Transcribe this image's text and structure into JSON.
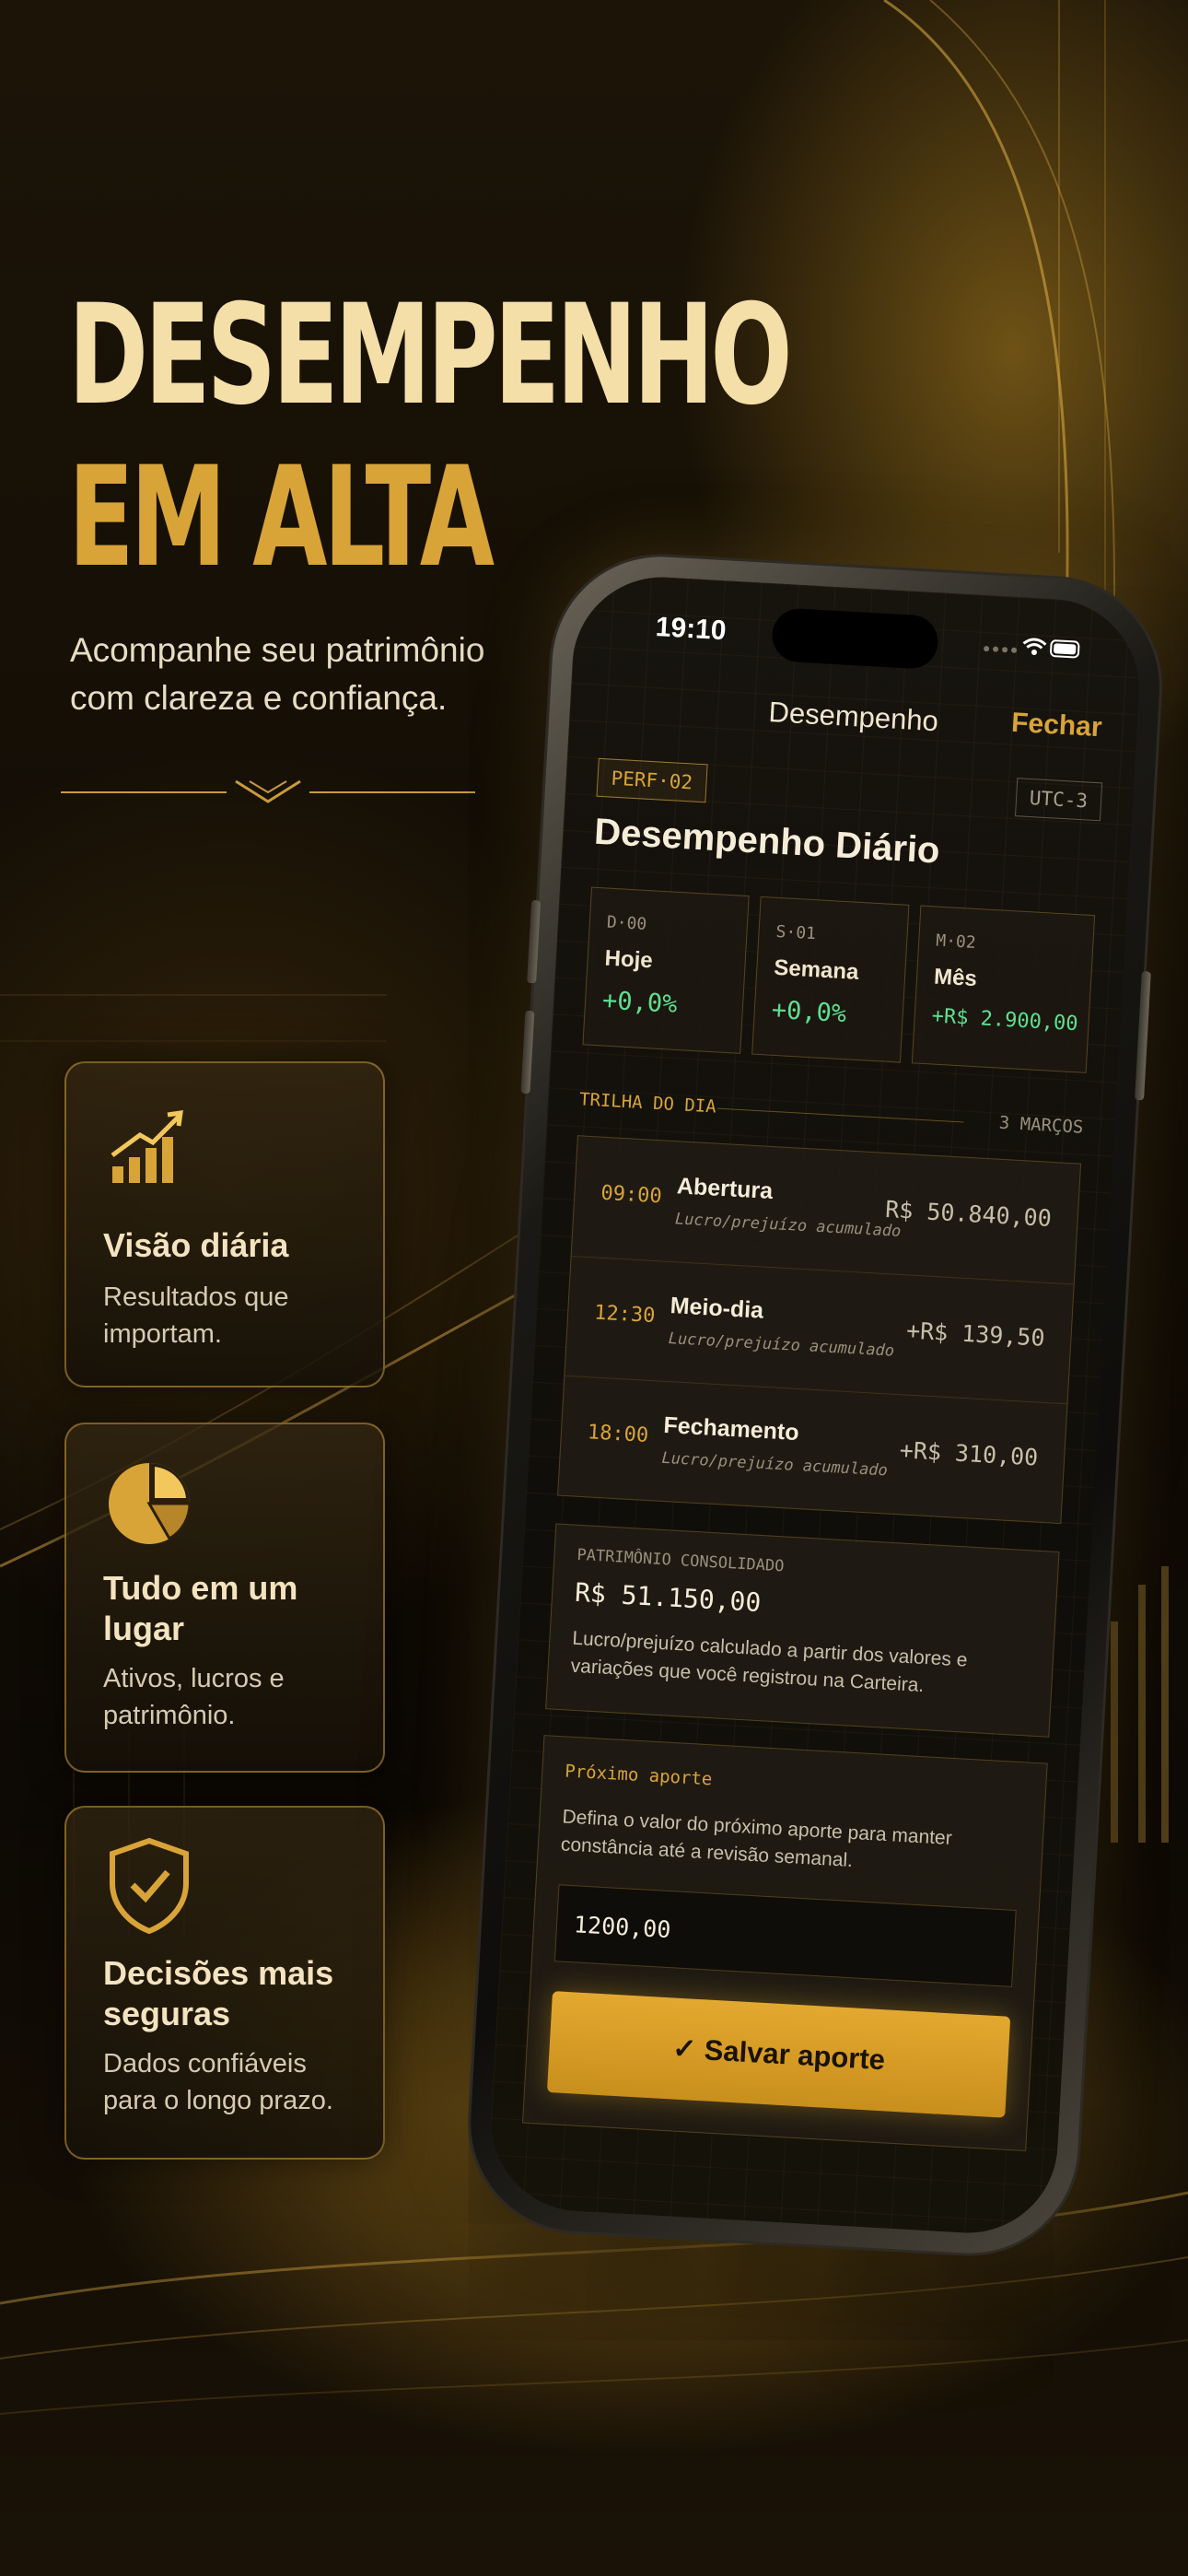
{
  "hero": {
    "title_line1": "DESEMPENHO",
    "title_line2": "EM ALTA",
    "subtitle": "Acompanhe seu patrimônio com clareza e confiança."
  },
  "features": [
    {
      "icon": "growth-chart-icon",
      "title": "Visão diária",
      "description": "Resultados que importam."
    },
    {
      "icon": "pie-chart-icon",
      "title": "Tudo em um lugar",
      "description": "Ativos, lucros e patrimônio."
    },
    {
      "icon": "shield-check-icon",
      "title": "Decisões mais seguras",
      "description": "Dados confiáveis para o longo prazo."
    }
  ],
  "phone": {
    "status": {
      "time": "19:10"
    },
    "nav": {
      "title": "Desempenho",
      "close_label": "Fechar"
    },
    "panel": {
      "tag": "PERF·02",
      "timezone": "UTC-3",
      "title": "Desempenho Diário",
      "stats": [
        {
          "code": "D·00",
          "label": "Hoje",
          "value": "+0,0%"
        },
        {
          "code": "S·01",
          "label": "Semana",
          "value": "+0,0%"
        },
        {
          "code": "M·02",
          "label": "Mês",
          "value": "+R$ 2.900,00"
        }
      ]
    },
    "trail": {
      "label": "TRILHA DO DIA",
      "date": "3 MARÇOS",
      "rows": [
        {
          "time": "09:00",
          "name": "Abertura",
          "sub": "Lucro/prejuízo acumulado",
          "value": "R$ 50.840,00"
        },
        {
          "time": "12:30",
          "name": "Meio-dia",
          "sub": "Lucro/prejuízo acumulado",
          "value": "+R$ 139,50"
        },
        {
          "time": "18:00",
          "name": "Fechamento",
          "sub": "Lucro/prejuízo acumulado",
          "value": "+R$ 310,00"
        }
      ]
    },
    "summary": {
      "label": "PATRIMÔNIO CONSOLIDADO",
      "value": "R$ 51.150,00",
      "note": "Lucro/prejuízo calculado a partir dos valores e variações que você registrou na Carteira."
    },
    "contribution": {
      "label": "Próximo aporte",
      "description": "Defina o valor do próximo aporte para manter constância até a revisão semanal.",
      "input_value": "1200,00",
      "save_label": "✓ Salvar aporte"
    }
  },
  "colors": {
    "accent": "#d9a437",
    "positive": "#5fe08f",
    "background": "#0c0903"
  }
}
